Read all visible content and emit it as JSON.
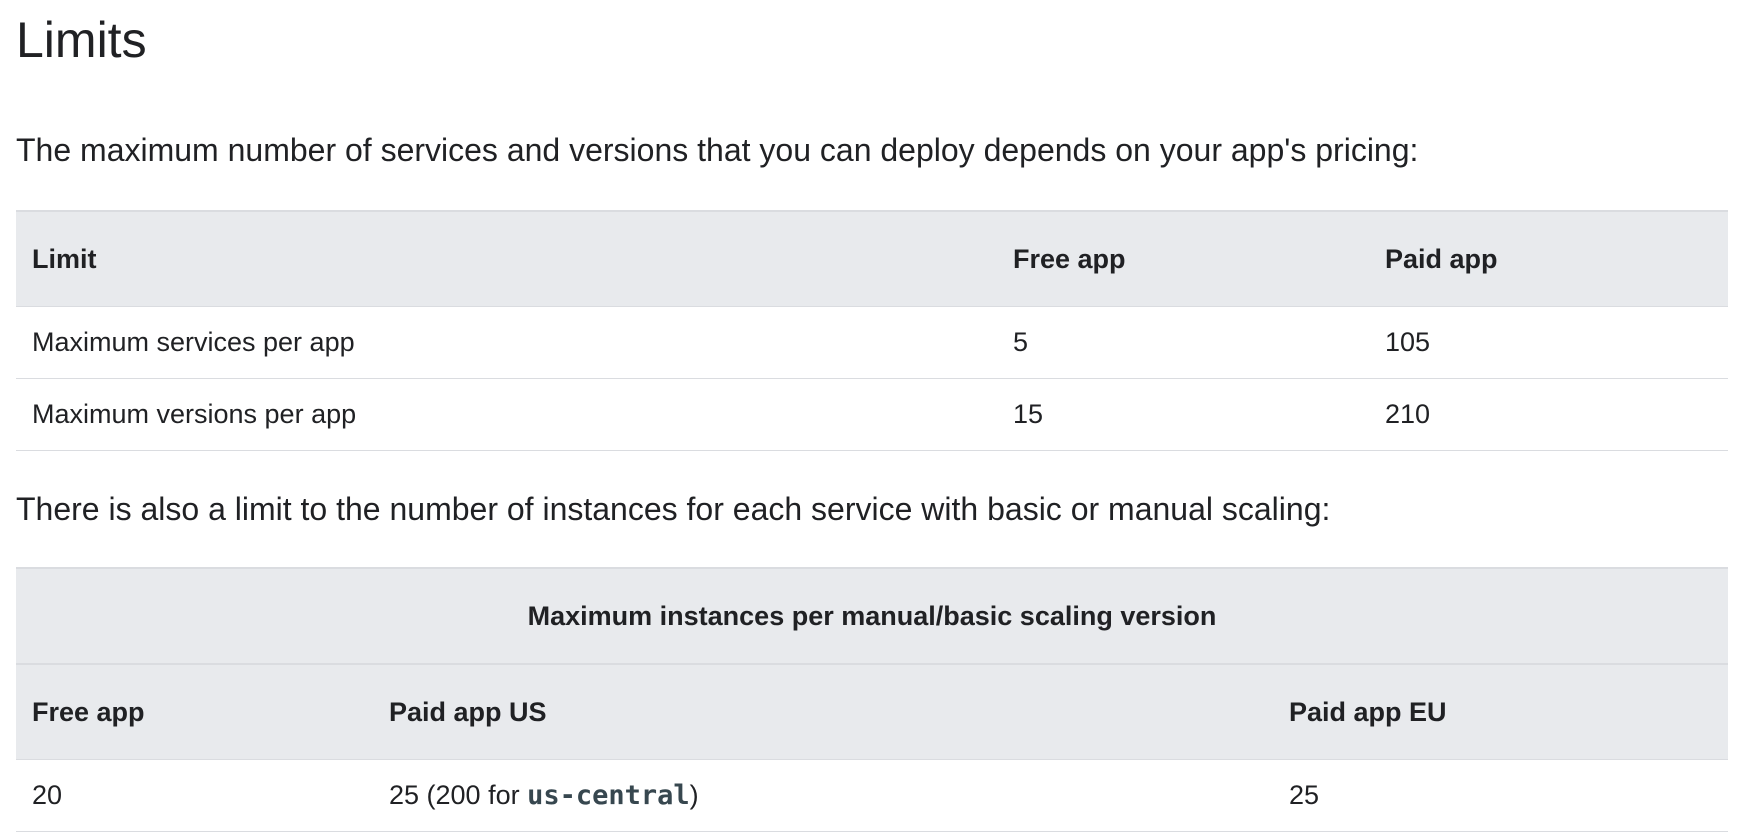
{
  "heading": "Limits",
  "intro_services": "The maximum number of services and versions that you can deploy depends on your app's pricing:",
  "services_table": {
    "headers": [
      "Limit",
      "Free app",
      "Paid app"
    ],
    "rows": [
      [
        "Maximum services per app",
        "5",
        "105"
      ],
      [
        "Maximum versions per app",
        "15",
        "210"
      ]
    ]
  },
  "intro_instances": "There is also a limit to the number of instances for each service with basic or manual scaling:",
  "instances_table": {
    "caption_header": "Maximum instances per manual/basic scaling version",
    "headers": [
      "Free app",
      "Paid app US",
      "Paid app EU"
    ],
    "row": {
      "free": "20",
      "paid_us_prefix": "25 (200 for ",
      "paid_us_code": "us-central",
      "paid_us_suffix": ")",
      "paid_eu": "25"
    }
  }
}
